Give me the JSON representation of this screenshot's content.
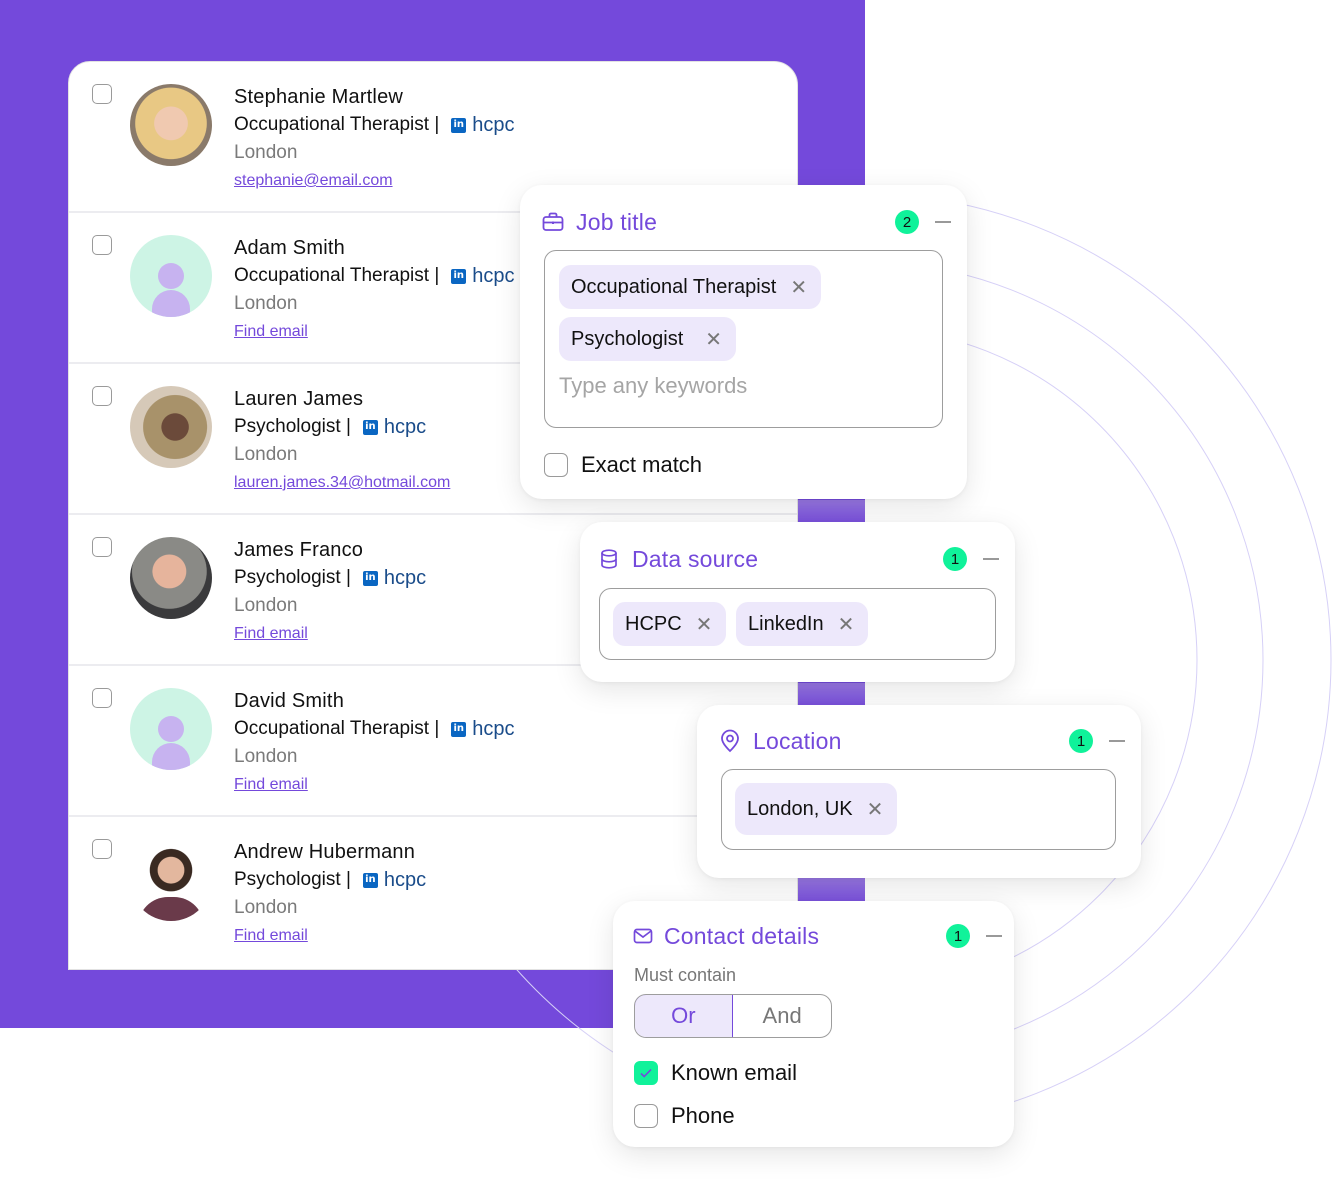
{
  "colors": {
    "brand_purple": "#7449db",
    "badge_green": "#10f29a",
    "tag_bg": "#ede8fb",
    "linkedin_blue": "#0a66c2",
    "hcpc_blue": "#1a4c8a"
  },
  "results": [
    {
      "name": "Stephanie Martlew",
      "job": "Occupational Therapist |",
      "source_icon": "linkedin-icon",
      "source": "hcpc",
      "city": "London",
      "email": "stephanie@email.com",
      "avatar": "photo",
      "checked": false
    },
    {
      "name": "Adam Smith",
      "job": "Occupational Therapist |",
      "source_icon": "linkedin-icon",
      "source": "hcpc",
      "city": "London",
      "email": "Find email",
      "avatar": "placeholder",
      "checked": false
    },
    {
      "name": "Lauren James",
      "job": "Psychologist |",
      "source_icon": "linkedin-icon",
      "source": "hcpc",
      "city": "London",
      "email": "lauren.james.34@hotmail.com",
      "avatar": "photo",
      "checked": false
    },
    {
      "name": "James Franco",
      "job": "Psychologist |",
      "source_icon": "linkedin-icon",
      "source": "hcpc",
      "city": "London",
      "email": "Find email",
      "avatar": "photo",
      "checked": false
    },
    {
      "name": "David Smith",
      "job": "Occupational Therapist |",
      "source_icon": "linkedin-icon",
      "source": "hcpc",
      "city": "London",
      "email": "Find email",
      "avatar": "placeholder",
      "checked": false
    },
    {
      "name": "Andrew Hubermann",
      "job": "Psychologist |",
      "source_icon": "linkedin-icon",
      "source": "hcpc",
      "city": "London",
      "email": "Find email",
      "avatar": "photo",
      "checked": false
    }
  ],
  "filters": {
    "job_title": {
      "icon": "briefcase-icon",
      "title": "Job title",
      "count": "2",
      "tags": [
        "Occupational Therapist",
        "Psychologist"
      ],
      "placeholder": "Type any keywords",
      "exact_match_label": "Exact match",
      "exact_match_checked": false
    },
    "data_source": {
      "icon": "database-icon",
      "title": "Data source",
      "count": "1",
      "tags": [
        "HCPC",
        "LinkedIn"
      ]
    },
    "location": {
      "icon": "map-pin-icon",
      "title": "Location",
      "count": "1",
      "tags": [
        "London, UK"
      ]
    },
    "contact_details": {
      "icon": "mail-icon",
      "title": "Contact details",
      "count": "1",
      "must_contain_label": "Must contain",
      "operators": [
        "Or",
        "And"
      ],
      "selected_operator": "Or",
      "options": [
        {
          "label": "Known email",
          "checked": true
        },
        {
          "label": "Phone",
          "checked": false
        }
      ]
    }
  },
  "tag_remove_glyph": "✕",
  "linkedin_glyph": "in"
}
